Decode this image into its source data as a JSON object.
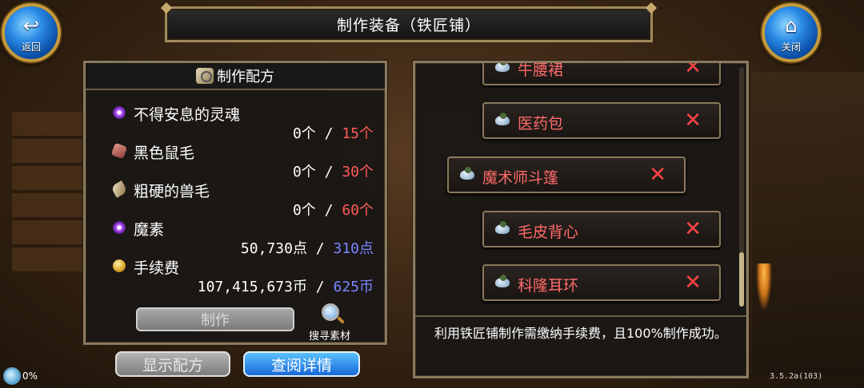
{
  "title": "制作装备（铁匠铺）",
  "back_button": {
    "label": "返回"
  },
  "close_button": {
    "label": "关闭"
  },
  "recipe_panel": {
    "header": "制作配方",
    "materials": [
      {
        "name": "不得安息的灵魂",
        "have": "0个",
        "need": "15个",
        "need_color": "red",
        "icon": "purple-orb-icon"
      },
      {
        "name": "黑色鼠毛",
        "have": "0个",
        "need": "30个",
        "need_color": "red",
        "icon": "fur-icon"
      },
      {
        "name": "粗硬的兽毛",
        "have": "0个",
        "need": "60个",
        "need_color": "red",
        "icon": "feather-icon"
      },
      {
        "name": "魔素",
        "have": "50,730点",
        "need": "310点",
        "need_color": "blue",
        "icon": "purple-orb-icon"
      },
      {
        "name": "手续费",
        "have": "107,415,673币",
        "need": "625币",
        "need_color": "blue",
        "icon": "coin-icon"
      }
    ],
    "separator": "/",
    "make_button": "制作",
    "search_label": "搜寻素材"
  },
  "bottom_buttons": {
    "show_recipe": "显示配方",
    "view_details": "查阅详情"
  },
  "recipe_list": {
    "items": [
      {
        "name": "牛腰裙",
        "partial": true
      },
      {
        "name": "医药包"
      },
      {
        "name": "魔术师斗篷",
        "selected": true
      },
      {
        "name": "毛皮背心"
      },
      {
        "name": "科隆耳环"
      }
    ],
    "remove_glyph": "✕"
  },
  "description": "利用铁匠铺制作需缴纳手续费，且100%制作成功。",
  "status": {
    "percent": "0%"
  },
  "version": "3.5.2a(103)",
  "colors": {
    "red": "#ff5a5a",
    "blue": "#7a86ff",
    "accent": "#1868d8",
    "frame": "#8a7a5c"
  }
}
